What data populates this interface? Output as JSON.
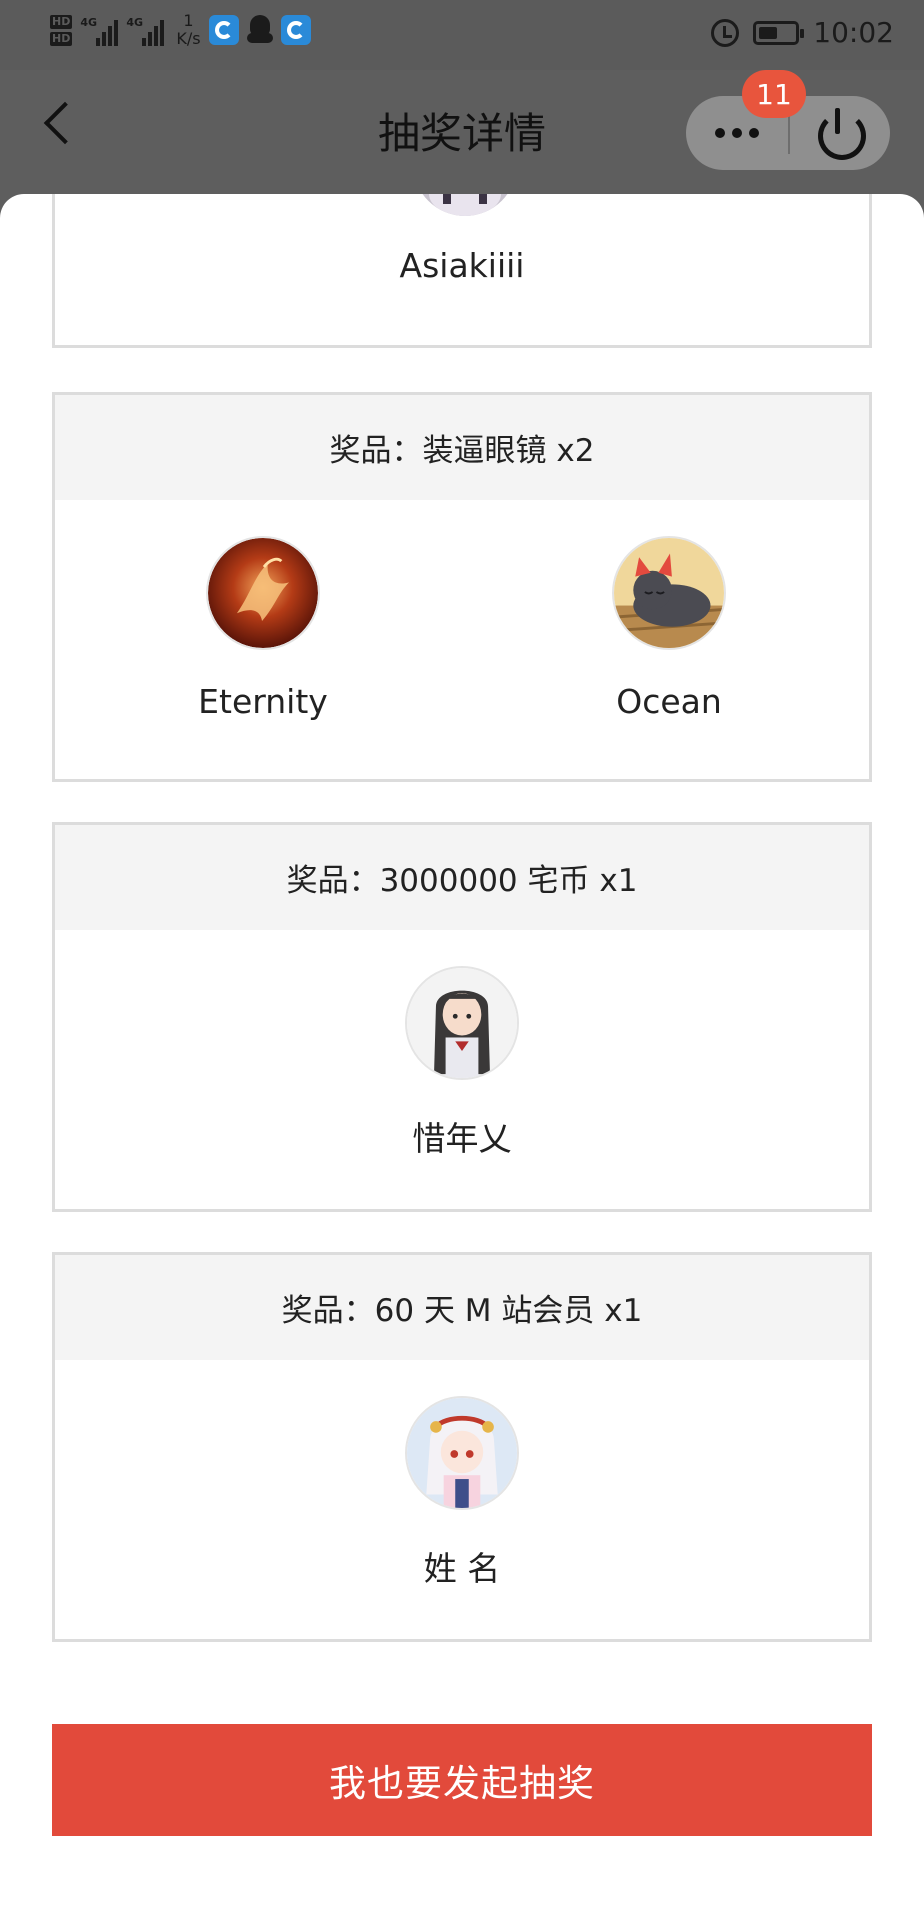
{
  "status_bar": {
    "hd_labels": [
      "HD",
      "HD"
    ],
    "network_labels": [
      "4G",
      "4G"
    ],
    "net_speed_value": "1",
    "net_speed_unit": "K/s",
    "time": "10:02",
    "icons": [
      "app-icon",
      "qq-icon",
      "app-icon",
      "alarm-icon",
      "battery-icon"
    ]
  },
  "nav": {
    "title": "抽奖详情",
    "badge_count": "11",
    "icons": [
      "back-arrow-icon",
      "more-dots-icon",
      "power-icon"
    ]
  },
  "previous_winner": {
    "name": "Asiakiiii"
  },
  "prizes": [
    {
      "title": "奖品：装逼眼镜 x2",
      "winners": [
        {
          "name": "Eternity",
          "avatar": "phoenix-avatar"
        },
        {
          "name": "Ocean",
          "avatar": "cat-avatar"
        }
      ]
    },
    {
      "title": "奖品：3000000 宅币 x1",
      "winners": [
        {
          "name": "惜年乂",
          "avatar": "anime-girl-dark-hair-avatar"
        }
      ]
    },
    {
      "title": "奖品：60 天 M 站会员 x1",
      "winners": [
        {
          "name": "姓 名",
          "avatar": "anime-girl-white-hair-avatar"
        }
      ]
    }
  ],
  "launch_button": {
    "label": "我也要发起抽奖"
  },
  "colors": {
    "accent": "#e24a3b",
    "badge": "#e8553d",
    "header_bg": "#f4f4f4",
    "card_border": "#dcdcdc",
    "overlay": "#5e5e5e"
  }
}
